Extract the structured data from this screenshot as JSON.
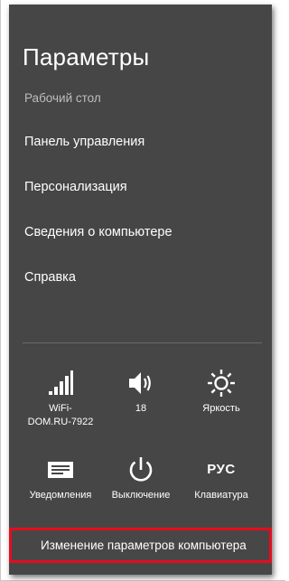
{
  "charm": {
    "title": "Параметры",
    "menu": [
      {
        "label": "Рабочий стол"
      },
      {
        "label": "Панель управления"
      },
      {
        "label": "Персонализация"
      },
      {
        "label": "Сведения о компьютере"
      },
      {
        "label": "Справка"
      }
    ]
  },
  "quick_settings": {
    "network": {
      "label_line1": "WiFi-",
      "label_line2": "DOM.RU-7922",
      "icon": "wifi-signal-icon"
    },
    "volume": {
      "label": "18",
      "icon": "speaker-icon"
    },
    "brightness": {
      "label": "Яркость",
      "icon": "sun-icon"
    },
    "notifications": {
      "label": "Уведомления",
      "icon": "notifications-icon"
    },
    "power": {
      "label": "Выключение",
      "icon": "power-icon"
    },
    "keyboard": {
      "label": "Клавиатура",
      "indicator": "РУС"
    }
  },
  "footer": {
    "change_settings_label": "Изменение параметров компьютера"
  },
  "colors": {
    "panel_background": "#464646",
    "highlight_border": "#e30d1e",
    "text": "#ffffff",
    "dim_text": "#bdbdbd"
  }
}
